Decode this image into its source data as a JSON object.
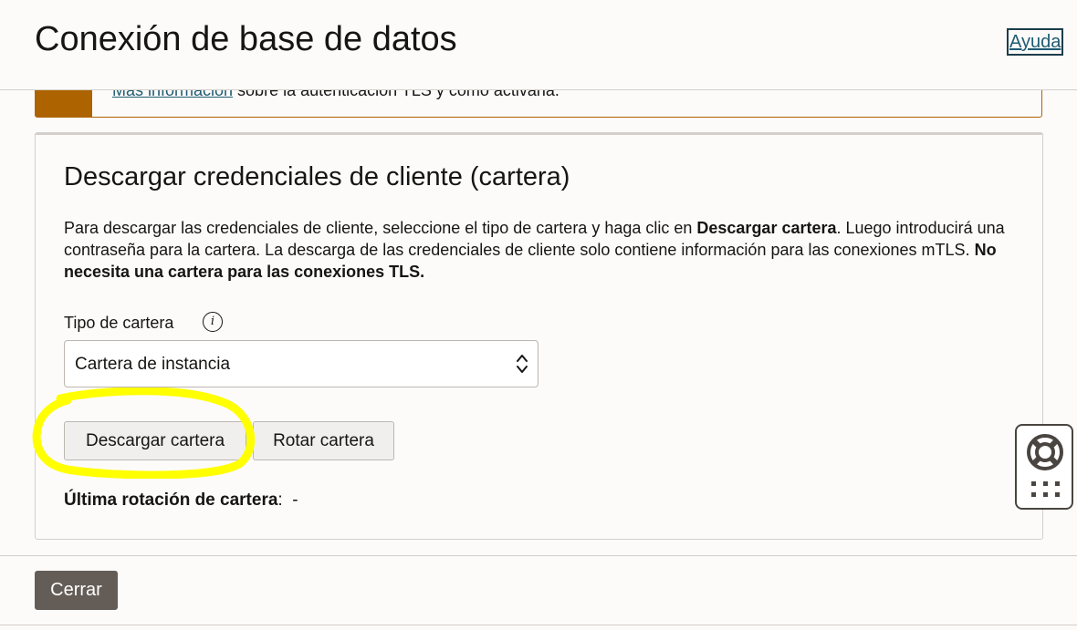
{
  "header": {
    "title": "Conexión de base de datos",
    "help_label": "Ayuda"
  },
  "notice": {
    "link_text": "Más información",
    "text": " sobre la autenticación TLS y cómo activarla.",
    "accent_color": "#ad6300"
  },
  "wallet_card": {
    "title": "Descargar credenciales de cliente (cartera)",
    "desc_part1": "Para descargar las credenciales de cliente, seleccione el tipo de cartera y haga clic en ",
    "desc_bold1": "Descargar cartera",
    "desc_part2": ". Luego introducirá una contraseña para la cartera. La descarga de las credenciales de cliente solo contiene información para las conexiones mTLS. ",
    "desc_bold2": "No necesita una cartera para las conexiones TLS.",
    "wallet_type_label": "Tipo de cartera",
    "wallet_type_value": "Cartera de instancia",
    "download_button": "Descargar cartera",
    "rotate_button": "Rotar cartera",
    "last_rotation_label": "Última rotación de cartera",
    "last_rotation_value": "-"
  },
  "footer": {
    "close_button": "Cerrar"
  },
  "colors": {
    "primary_button": "#645d57",
    "link": "#1f5c73",
    "highlight": "#ffff00"
  }
}
